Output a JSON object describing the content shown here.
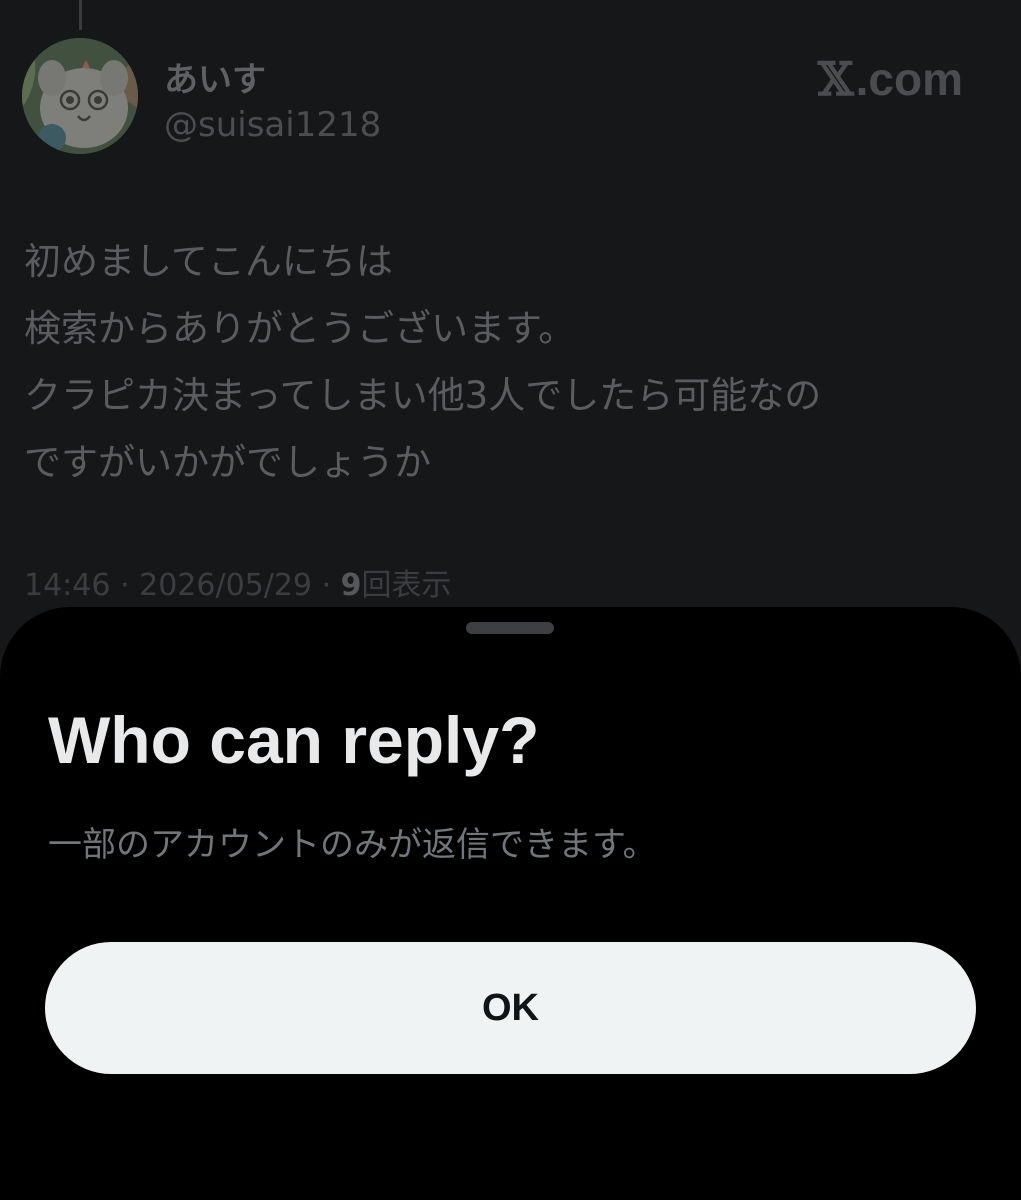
{
  "tweet": {
    "display_name": "あいす",
    "handle": "@suisai1218",
    "body_lines": [
      "初めましてこんにちは",
      "検索からありがとうございます。",
      "クラピカ決まってしまい他3人でしたら可能なの",
      "ですがいかがでしょうか"
    ],
    "time": "14:46",
    "date": "2026/05/29",
    "views_count": "9",
    "views_label": "回表示",
    "separator": "·"
  },
  "watermark": {
    "x_glyph": "𝕏",
    "text": ".com"
  },
  "sheet": {
    "title": "Who can reply?",
    "description": "一部のアカウントのみが返信できます。",
    "ok_label": "OK"
  },
  "colors": {
    "background": "#161719",
    "sheet_background": "#000000",
    "button_background": "#eff3f4",
    "button_text": "#0f1419",
    "title_text": "#e7e9ea",
    "secondary_text": "#71767b"
  },
  "icons": {
    "avatar": "illustrated-cat-avatar",
    "brand": "x-logo-icon"
  }
}
